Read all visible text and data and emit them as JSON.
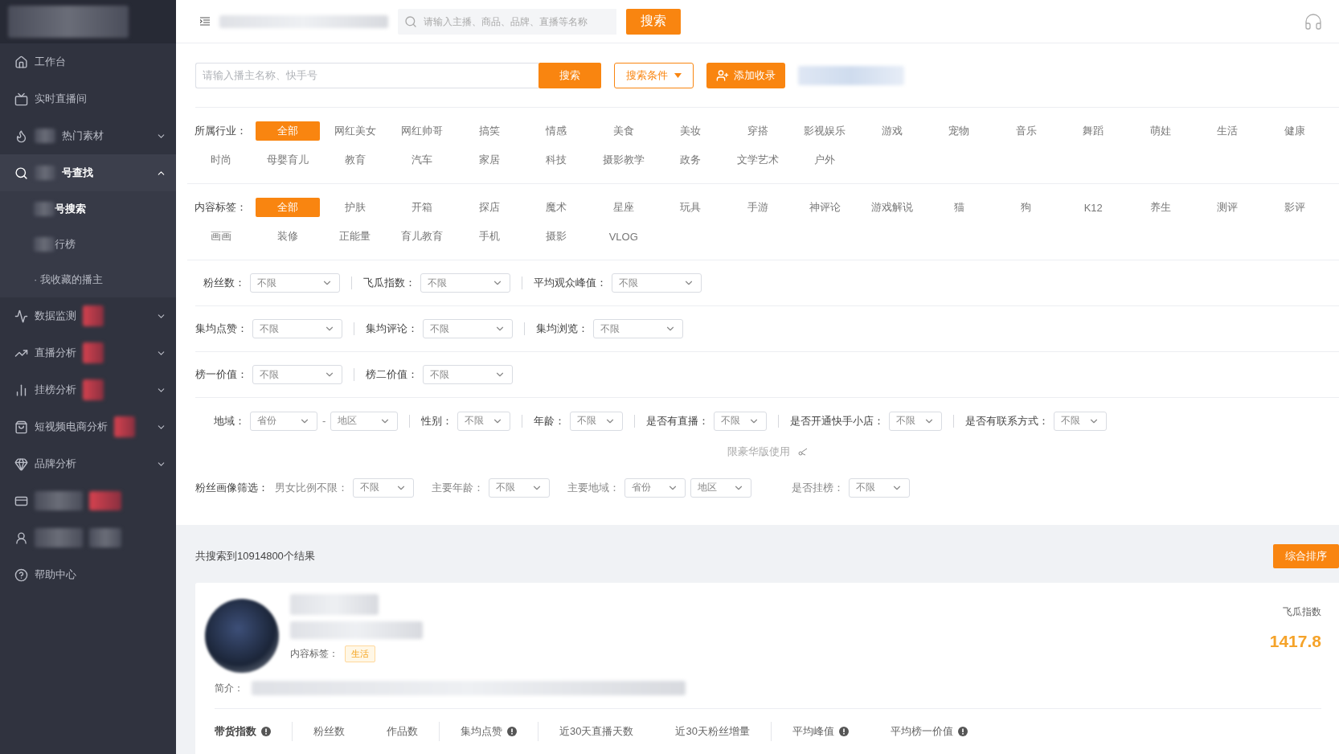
{
  "sidebar": {
    "items": [
      {
        "label": "工作台",
        "kind": "link",
        "selected": false
      },
      {
        "label": "实时直播间",
        "kind": "link",
        "selected": false
      },
      {
        "label": "热门素材",
        "kind": "group",
        "expanded": false,
        "selected": false
      },
      {
        "label": "号查找",
        "kind": "group",
        "expanded": true,
        "selected": true,
        "children": [
          {
            "label": "号搜索",
            "selected": true
          },
          {
            "label": "行榜",
            "selected": false
          },
          {
            "label": "· 我收藏的播主",
            "selected": false
          }
        ]
      },
      {
        "label": "数据监测",
        "kind": "group",
        "expanded": false,
        "selected": false
      },
      {
        "label": "直播分析",
        "kind": "group",
        "expanded": false,
        "selected": false
      },
      {
        "label": "挂榜分析",
        "kind": "group",
        "expanded": false,
        "selected": false
      },
      {
        "label": "短视频电商分析",
        "kind": "group",
        "expanded": false,
        "selected": false
      },
      {
        "label": "品牌分析",
        "kind": "group",
        "expanded": false,
        "selected": false
      },
      {
        "kind": "link",
        "selected": false
      },
      {
        "kind": "link",
        "selected": false
      },
      {
        "label": "帮助中心",
        "kind": "link",
        "selected": false
      }
    ]
  },
  "header": {
    "search": {
      "placeholder": "请输入主播、商品、品牌、直播等名称"
    },
    "search_button": "搜索"
  },
  "search_row": {
    "placeholder": "请输入播主名称、快手号",
    "search_button": "搜索",
    "conditions_button": "搜索条件",
    "add_button": "添加收录"
  },
  "tag_groups": [
    {
      "label": "所属行业：",
      "tags": [
        {
          "label": "全部",
          "selected": true
        },
        {
          "label": "网红美女",
          "selected": false
        },
        {
          "label": "网红帅哥",
          "selected": false
        },
        {
          "label": "搞笑",
          "selected": false
        },
        {
          "label": "情感",
          "selected": false
        },
        {
          "label": "美食",
          "selected": false
        },
        {
          "label": "美妆",
          "selected": false
        },
        {
          "label": "穿搭",
          "selected": false
        },
        {
          "label": "影视娱乐",
          "selected": false
        },
        {
          "label": "游戏",
          "selected": false
        },
        {
          "label": "宠物",
          "selected": false
        },
        {
          "label": "音乐",
          "selected": false
        },
        {
          "label": "舞蹈",
          "selected": false
        },
        {
          "label": "萌娃",
          "selected": false
        },
        {
          "label": "生活",
          "selected": false
        },
        {
          "label": "健康",
          "selected": false
        },
        {
          "label": "时尚",
          "selected": false
        },
        {
          "label": "母婴育儿",
          "selected": false
        },
        {
          "label": "教育",
          "selected": false
        },
        {
          "label": "汽车",
          "selected": false
        },
        {
          "label": "家居",
          "selected": false
        },
        {
          "label": "科技",
          "selected": false
        },
        {
          "label": "摄影教学",
          "selected": false
        },
        {
          "label": "政务",
          "selected": false
        },
        {
          "label": "文学艺术",
          "selected": false
        },
        {
          "label": "户外",
          "selected": false
        }
      ]
    },
    {
      "label": "内容标签：",
      "tags": [
        {
          "label": "全部",
          "selected": true
        },
        {
          "label": "护肤",
          "selected": false
        },
        {
          "label": "开箱",
          "selected": false
        },
        {
          "label": "探店",
          "selected": false
        },
        {
          "label": "魔术",
          "selected": false
        },
        {
          "label": "星座",
          "selected": false
        },
        {
          "label": "玩具",
          "selected": false
        },
        {
          "label": "手游",
          "selected": false
        },
        {
          "label": "神评论",
          "selected": false
        },
        {
          "label": "游戏解说",
          "selected": false
        },
        {
          "label": "猫",
          "selected": false
        },
        {
          "label": "狗",
          "selected": false
        },
        {
          "label": "K12",
          "selected": false
        },
        {
          "label": "养生",
          "selected": false
        },
        {
          "label": "测评",
          "selected": false
        },
        {
          "label": "影评",
          "selected": false
        },
        {
          "label": "画画",
          "selected": false
        },
        {
          "label": "装修",
          "selected": false
        },
        {
          "label": "正能量",
          "selected": false
        },
        {
          "label": "育儿教育",
          "selected": false
        },
        {
          "label": "手机",
          "selected": false
        },
        {
          "label": "摄影",
          "selected": false
        },
        {
          "label": "VLOG",
          "selected": false
        }
      ]
    }
  ],
  "filter_rows": [
    {
      "fields": [
        {
          "label": "粉丝数：",
          "selects": [
            "不限"
          ]
        },
        {
          "label": "飞瓜指数：",
          "selects": [
            "不限"
          ]
        },
        {
          "label": "平均观众峰值：",
          "selects": [
            "不限"
          ]
        }
      ]
    },
    {
      "fields": [
        {
          "label": "集均点赞：",
          "selects": [
            "不限"
          ]
        },
        {
          "label": "集均评论：",
          "selects": [
            "不限"
          ]
        },
        {
          "label": "集均浏览：",
          "selects": [
            "不限"
          ]
        }
      ]
    },
    {
      "fields": [
        {
          "label": "榜一价值：",
          "selects": [
            "不限"
          ]
        },
        {
          "label": "榜二价值：",
          "selects": [
            "不限"
          ]
        }
      ]
    },
    {
      "fields": [
        {
          "label": "地域：",
          "selects": [
            "省份",
            "地区"
          ],
          "separator": "-"
        },
        {
          "label": "性别：",
          "selects": [
            "不限"
          ]
        },
        {
          "label": "年龄：",
          "selects": [
            "不限"
          ]
        },
        {
          "label": "是否有直播：",
          "selects": [
            "不限"
          ]
        },
        {
          "label": "是否开通快手小店：",
          "selects": [
            "不限"
          ]
        },
        {
          "label": "是否有联系方式：",
          "selects": [
            "不限"
          ]
        }
      ]
    }
  ],
  "premium_note": "限豪华版使用",
  "portrait_filter": {
    "title": "粉丝画像筛选：",
    "fields": [
      {
        "label": "男女比例不限：",
        "selects": [
          "不限"
        ]
      },
      {
        "label": "主要年龄：",
        "selects": [
          "不限"
        ]
      },
      {
        "label": "主要地域：",
        "selects": [
          "省份",
          "地区"
        ]
      },
      {
        "label": "是否挂榜：",
        "selects": [
          "不限"
        ]
      }
    ]
  },
  "results": {
    "count_text": "共搜索到10914800个结果",
    "sort_button": "综合排序"
  },
  "result_card": {
    "tag_label": "内容标签：",
    "tag": "生活",
    "intro_label": "简介：",
    "index_label": "飞瓜指数",
    "index_value": "1417.8",
    "stats": [
      {
        "label": "带货指数",
        "info": true,
        "divider": false
      },
      {
        "label": "粉丝数",
        "info": false,
        "divider": true
      },
      {
        "label": "作品数",
        "info": false,
        "divider": false
      },
      {
        "label": "集均点赞",
        "info": true,
        "divider": true
      },
      {
        "label": "近30天直播天数",
        "info": false,
        "divider": true
      },
      {
        "label": "近30天粉丝增量",
        "info": false,
        "divider": false
      },
      {
        "label": "平均峰值",
        "info": true,
        "divider": true
      },
      {
        "label": "平均榜一价值",
        "info": true,
        "divider": false
      }
    ]
  }
}
